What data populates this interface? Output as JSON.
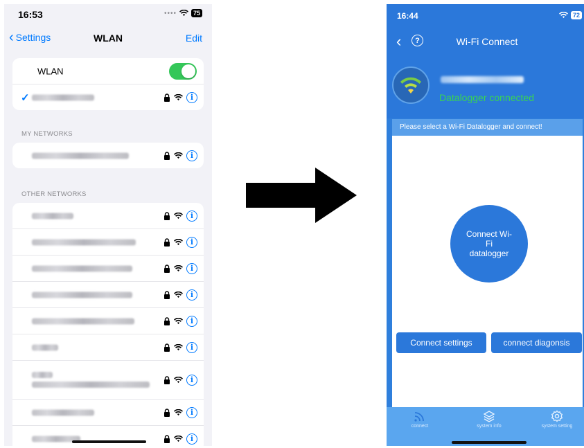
{
  "left": {
    "status_time": "16:53",
    "battery": "75",
    "nav_back_label": "Settings",
    "nav_title": "WLAN",
    "nav_edit": "Edit",
    "wlan_label": "WLAN",
    "wlan_toggle_on": 100,
    "my_networks_header": "MY NETWORKS",
    "other_networks_header": "OTHER NETWORKS"
  },
  "right": {
    "status_time": "16:44",
    "battery": "72",
    "nav_title": "Wi-Fi Connect",
    "help_glyph": "?",
    "connected_status": "Datalogger connected",
    "banner": "Please select a Wi-Fi Datalogger and connect!",
    "connect_circle": "Connect Wi-Fi datalogger",
    "connect_settings": "Connect settings",
    "connect_diagnosis": "connect diagonsis",
    "tabs": [
      {
        "label": "connect",
        "icon": "wifi-waves-icon"
      },
      {
        "label": "system info",
        "icon": "layers-icon"
      },
      {
        "label": "system setting",
        "icon": "gear-icon"
      }
    ]
  },
  "colors": {
    "ios_blue": "#007aff",
    "toggle_green": "#34c759",
    "app_blue": "#2b78da",
    "connected_green": "#39d353"
  }
}
